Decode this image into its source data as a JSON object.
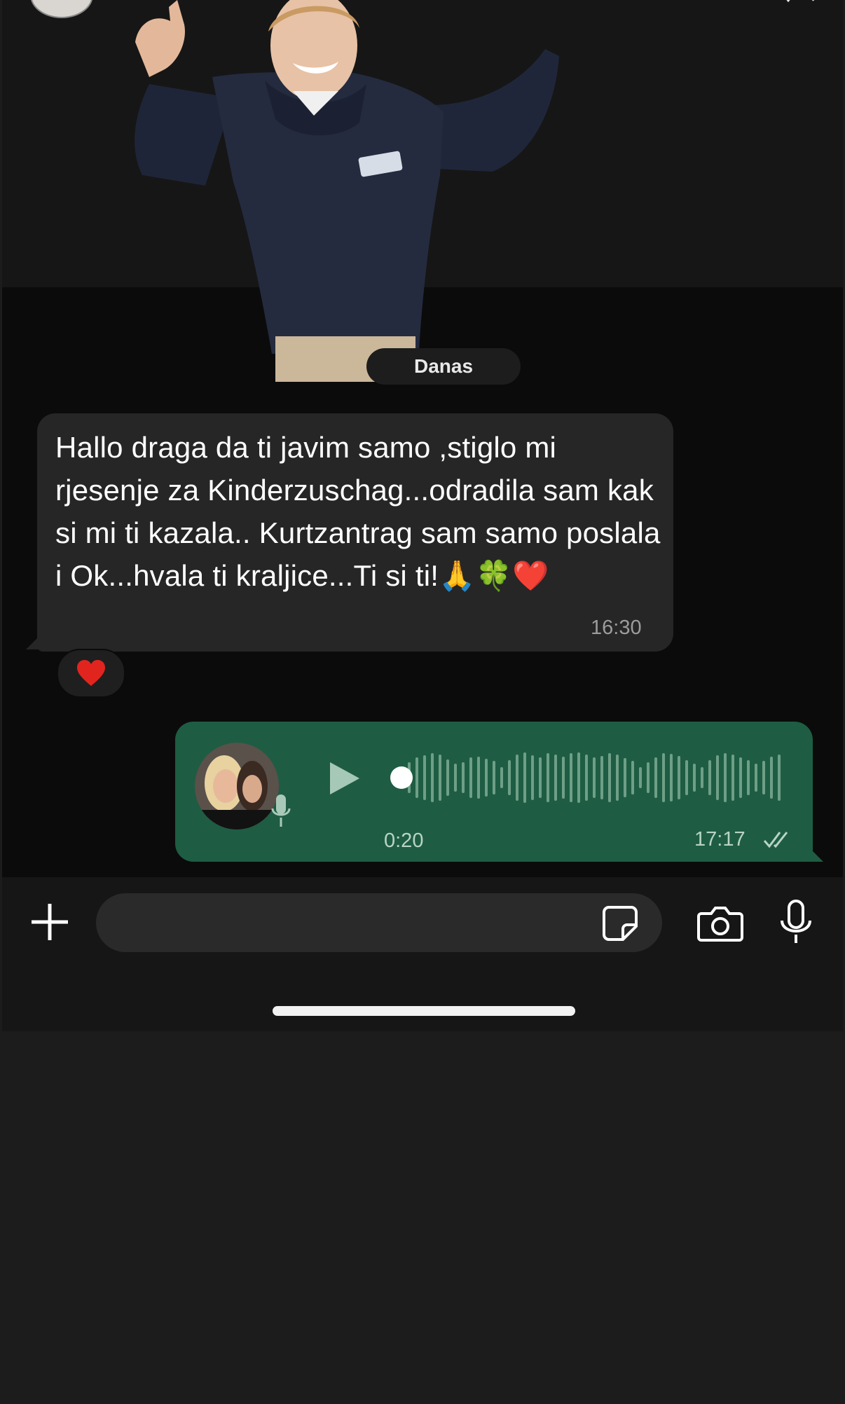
{
  "chat": {
    "date_separator": "Danas",
    "incoming": {
      "text": "Hallo draga da ti javim samo ,stiglo mi rjesenje za Kinderzuschag...odradila sam kak si mi ti kazala.. Kurtzantrag sam samo poslala i Ok...hvala ti kraljice...Ti si ti!🙏🍀❤️",
      "time": "16:30",
      "reaction": "❤️"
    },
    "outgoing_voice": {
      "duration": "0:20",
      "time": "17:17",
      "status_icon": "double-check-icon",
      "playback_progress": 0
    }
  },
  "composer": {
    "placeholder": "",
    "value": ""
  },
  "colors": {
    "background": "#0b0b0b",
    "incoming_bubble": "#262626",
    "outgoing_bubble": "#1e5d43",
    "input_bar": "#161616"
  },
  "icons": {
    "add": "plus-icon",
    "sticker": "sticker-icon",
    "camera": "camera-icon",
    "mic": "microphone-icon",
    "play": "play-icon"
  }
}
